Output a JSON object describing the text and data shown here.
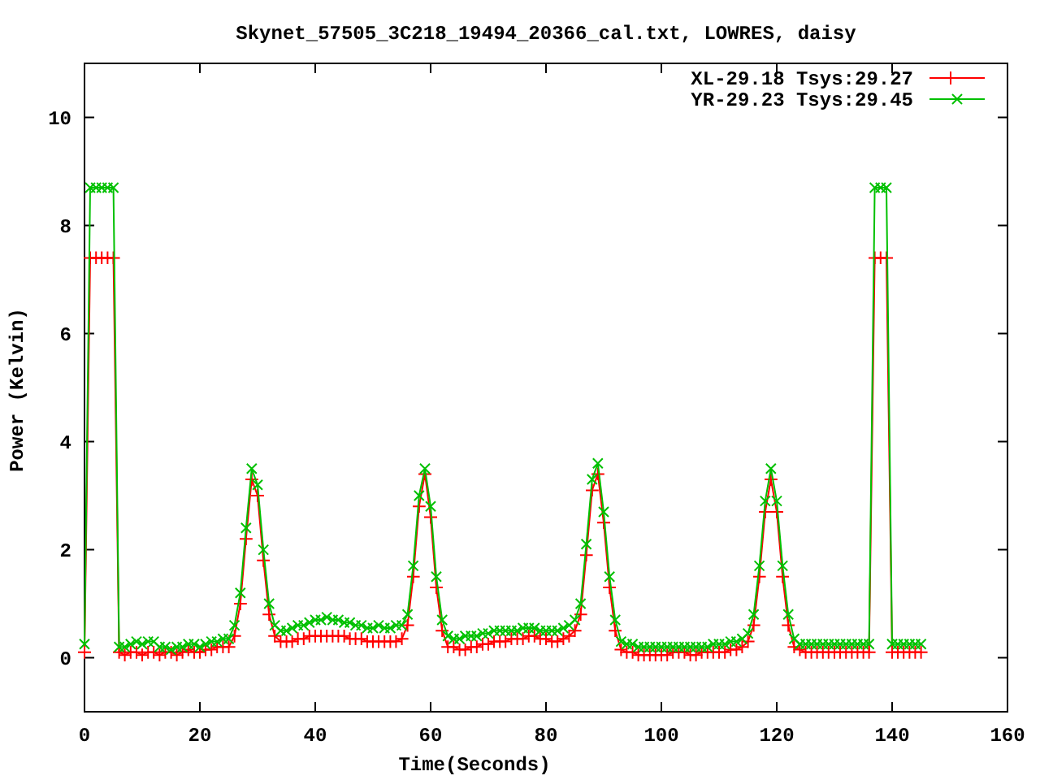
{
  "plot": {
    "chart_data": {
      "type": "line",
      "legend": "upper right",
      "title": "Skynet_57505_3C218_19494_20366_cal.txt, LOWRES, daisy",
      "xlabel": "Time(Seconds)",
      "ylabel": "Power (Kelvin)",
      "xlim": [
        0,
        160
      ],
      "ylim": [
        -1,
        11
      ],
      "xticks": [
        0,
        20,
        40,
        60,
        80,
        100,
        120,
        140,
        160
      ],
      "yticks": [
        0,
        2,
        4,
        6,
        8,
        10
      ],
      "x": [
        0,
        1,
        2,
        3,
        4,
        5,
        6,
        7,
        8,
        9,
        10,
        11,
        12,
        13,
        14,
        15,
        16,
        17,
        18,
        19,
        20,
        21,
        22,
        23,
        24,
        25,
        26,
        27,
        28,
        29,
        30,
        31,
        32,
        33,
        34,
        35,
        36,
        37,
        38,
        39,
        40,
        41,
        42,
        43,
        44,
        45,
        46,
        47,
        48,
        49,
        50,
        51,
        52,
        53,
        54,
        55,
        56,
        57,
        58,
        59,
        60,
        61,
        62,
        63,
        64,
        65,
        66,
        67,
        68,
        69,
        70,
        71,
        72,
        73,
        74,
        75,
        76,
        77,
        78,
        79,
        80,
        81,
        82,
        83,
        84,
        85,
        86,
        87,
        88,
        89,
        90,
        91,
        92,
        93,
        94,
        95,
        96,
        97,
        98,
        99,
        100,
        101,
        102,
        103,
        104,
        105,
        106,
        107,
        108,
        109,
        110,
        111,
        112,
        113,
        114,
        115,
        116,
        117,
        118,
        119,
        120,
        121,
        122,
        123,
        124,
        125,
        126,
        127,
        128,
        129,
        130,
        131,
        132,
        133,
        134,
        135,
        136,
        137,
        138,
        139,
        140,
        141,
        142,
        143,
        144,
        145
      ],
      "series": [
        {
          "name": "XL-29.18 Tsys:29.27",
          "color": "#ff0000",
          "values": [
            0.1,
            7.4,
            7.4,
            7.4,
            7.4,
            7.4,
            0.1,
            0.05,
            0.1,
            0.1,
            0.05,
            0.1,
            0.1,
            0.05,
            0.1,
            0.1,
            0.05,
            0.1,
            0.15,
            0.1,
            0.1,
            0.15,
            0.15,
            0.2,
            0.2,
            0.2,
            0.4,
            1.0,
            2.2,
            3.3,
            3.0,
            1.8,
            0.8,
            0.4,
            0.3,
            0.3,
            0.3,
            0.35,
            0.35,
            0.4,
            0.4,
            0.4,
            0.4,
            0.4,
            0.4,
            0.4,
            0.35,
            0.35,
            0.35,
            0.3,
            0.3,
            0.3,
            0.3,
            0.3,
            0.3,
            0.35,
            0.6,
            1.5,
            2.8,
            3.4,
            2.6,
            1.3,
            0.5,
            0.2,
            0.2,
            0.15,
            0.15,
            0.2,
            0.2,
            0.25,
            0.25,
            0.3,
            0.3,
            0.3,
            0.35,
            0.35,
            0.35,
            0.4,
            0.4,
            0.35,
            0.35,
            0.3,
            0.3,
            0.35,
            0.4,
            0.5,
            0.8,
            1.9,
            3.1,
            3.4,
            2.5,
            1.3,
            0.5,
            0.15,
            0.1,
            0.1,
            0.05,
            0.05,
            0.05,
            0.05,
            0.05,
            0.05,
            0.1,
            0.1,
            0.1,
            0.05,
            0.05,
            0.1,
            0.1,
            0.1,
            0.1,
            0.1,
            0.15,
            0.15,
            0.2,
            0.3,
            0.6,
            1.5,
            2.7,
            3.3,
            2.7,
            1.5,
            0.6,
            0.2,
            0.15,
            0.1,
            0.1,
            0.1,
            0.1,
            0.1,
            0.1,
            0.1,
            0.1,
            0.1,
            0.1,
            0.1,
            0.1,
            7.4,
            7.4,
            7.4,
            0.1,
            0.1,
            0.1,
            0.1,
            0.1,
            0.1
          ]
        },
        {
          "name": "YR-29.23 Tsys:29.45",
          "color": "#00c000",
          "values": [
            0.25,
            8.7,
            8.7,
            8.7,
            8.7,
            8.7,
            0.2,
            0.2,
            0.25,
            0.3,
            0.25,
            0.3,
            0.3,
            0.2,
            0.2,
            0.15,
            0.2,
            0.2,
            0.25,
            0.25,
            0.2,
            0.25,
            0.3,
            0.3,
            0.35,
            0.35,
            0.6,
            1.2,
            2.4,
            3.5,
            3.2,
            2.0,
            1.0,
            0.6,
            0.5,
            0.5,
            0.55,
            0.6,
            0.6,
            0.65,
            0.7,
            0.7,
            0.75,
            0.7,
            0.7,
            0.65,
            0.65,
            0.6,
            0.6,
            0.55,
            0.55,
            0.6,
            0.55,
            0.55,
            0.6,
            0.6,
            0.8,
            1.7,
            3.0,
            3.5,
            2.8,
            1.5,
            0.7,
            0.4,
            0.35,
            0.35,
            0.4,
            0.4,
            0.4,
            0.45,
            0.45,
            0.5,
            0.5,
            0.5,
            0.5,
            0.5,
            0.55,
            0.55,
            0.55,
            0.5,
            0.5,
            0.5,
            0.5,
            0.55,
            0.6,
            0.7,
            1.0,
            2.1,
            3.3,
            3.6,
            2.7,
            1.5,
            0.7,
            0.3,
            0.25,
            0.25,
            0.2,
            0.2,
            0.2,
            0.2,
            0.2,
            0.2,
            0.2,
            0.2,
            0.2,
            0.2,
            0.2,
            0.2,
            0.2,
            0.25,
            0.25,
            0.25,
            0.3,
            0.3,
            0.35,
            0.45,
            0.8,
            1.7,
            2.9,
            3.5,
            2.9,
            1.7,
            0.8,
            0.35,
            0.25,
            0.25,
            0.25,
            0.25,
            0.25,
            0.25,
            0.25,
            0.25,
            0.25,
            0.25,
            0.25,
            0.25,
            0.25,
            8.7,
            8.7,
            8.7,
            0.25,
            0.25,
            0.25,
            0.25,
            0.25,
            0.25
          ]
        }
      ]
    }
  }
}
